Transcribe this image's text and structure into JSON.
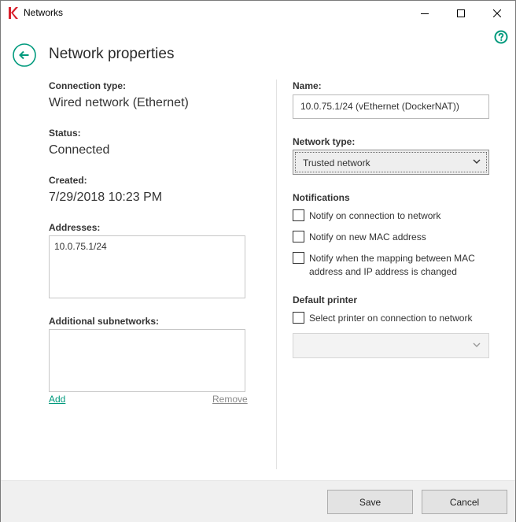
{
  "window": {
    "title": "Networks"
  },
  "header": {
    "title": "Network properties"
  },
  "left": {
    "connection_type_label": "Connection type:",
    "connection_type_value": "Wired network (Ethernet)",
    "status_label": "Status:",
    "status_value": "Connected",
    "created_label": "Created:",
    "created_value": "7/29/2018 10:23 PM",
    "addresses_label": "Addresses:",
    "addresses": [
      "10.0.75.1/24"
    ],
    "subnetworks_label": "Additional subnetworks:",
    "subnetworks": [],
    "add_link": "Add",
    "remove_link": "Remove"
  },
  "right": {
    "name_label": "Name:",
    "name_value": "10.0.75.1/24 (vEthernet (DockerNAT))",
    "network_type_label": "Network type:",
    "network_type_value": "Trusted network",
    "notifications_label": "Notifications",
    "notify_connection": {
      "label": "Notify on connection to network",
      "checked": false
    },
    "notify_mac": {
      "label": "Notify on new MAC address",
      "checked": false
    },
    "notify_mapping": {
      "label": "Notify when the mapping between MAC address and IP address is changed",
      "checked": false
    },
    "default_printer_label": "Default printer",
    "select_printer": {
      "label": "Select printer on connection to network",
      "checked": false
    },
    "printer_value": ""
  },
  "footer": {
    "save_label": "Save",
    "cancel_label": "Cancel"
  },
  "colors": {
    "accent": "#009a7d",
    "link_disabled": "#8a8a8a",
    "logo_red": "#d8202c"
  },
  "icons": {
    "app_logo": "kaspersky-logo-icon",
    "help": "help-icon",
    "back": "back-arrow-icon",
    "dropdown": "chevron-down-icon"
  }
}
